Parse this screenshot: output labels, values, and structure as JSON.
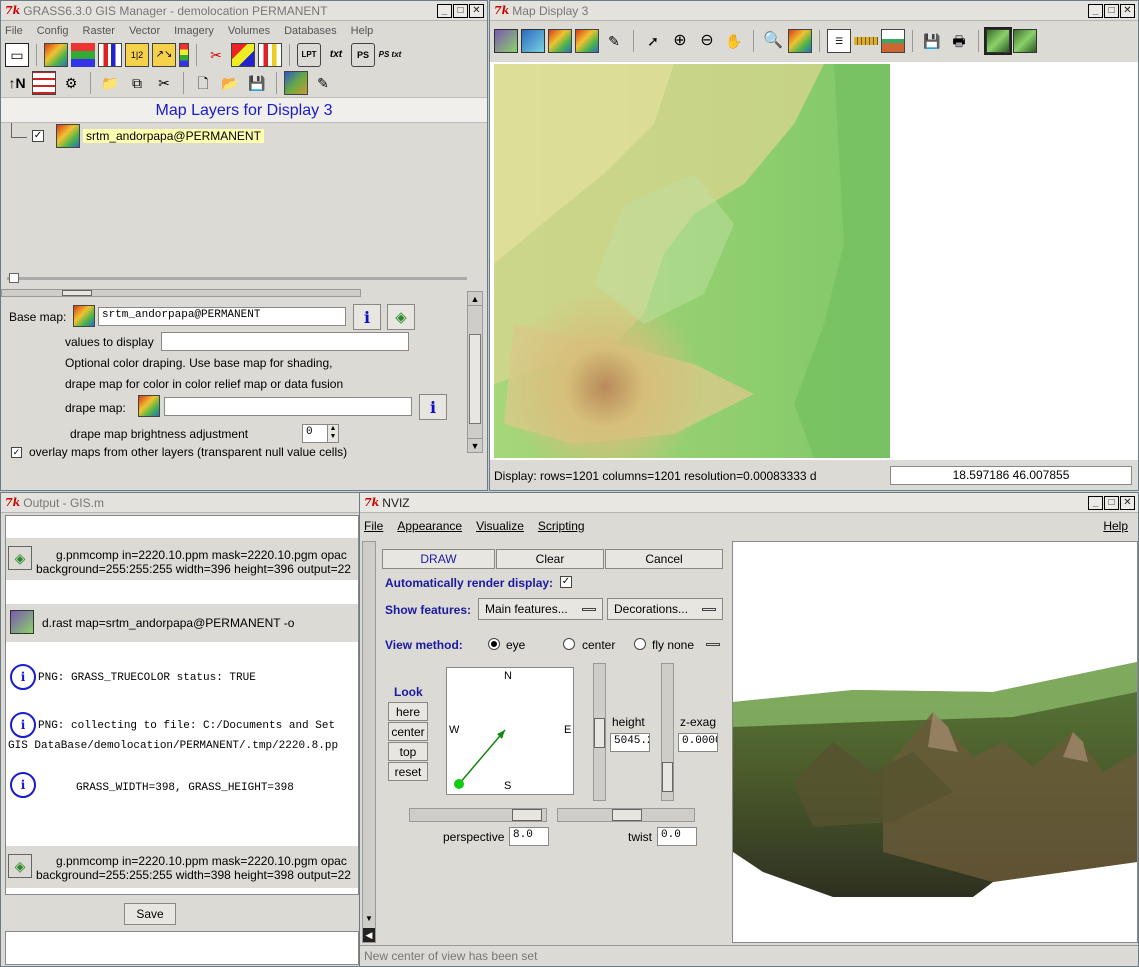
{
  "gis_manager": {
    "title": "GRASS6.3.0 GIS Manager - demolocation PERMANENT",
    "menu": [
      "File",
      "Config",
      "Raster",
      "Vector",
      "Imagery",
      "Volumes",
      "Databases",
      "Help"
    ],
    "toolbar1_labels": {
      "lpt": "LPT",
      "txt": "txt",
      "ps": "PS",
      "pstxt": "PS txt"
    },
    "panel_title": "Map Layers for Display 3",
    "layer_name": "srtm_andorpapa@PERMANENT",
    "base_map_label": "Base map:",
    "base_map_value": "srtm_andorpapa@PERMANENT",
    "values_label": "values to display",
    "values_value": "",
    "optional_text1": "Optional color draping. Use base map for shading,",
    "optional_text2": "drape map for color in color relief map or data fusion",
    "drape_label": "drape map:",
    "drape_value": "",
    "brightness_label": "drape map brightness adjustment",
    "brightness_value": "0",
    "overlay_text": "overlay maps from other layers (transparent null value cells)"
  },
  "map_display": {
    "title": "Map Display 3",
    "status_text": "Display: rows=1201 columns=1201  resolution=0.00083333 d",
    "coords": "18.597186 46.007855"
  },
  "output": {
    "title": "Output - GIS.m",
    "entries": [
      {
        "line1": "g.pnmcomp in=2220.10.ppm mask=2220.10.pgm opac",
        "line2": "background=255:255:255 width=396 height=396 output=22"
      },
      {
        "line1": "d.rast map=srtm_andorpapa@PERMANENT -o"
      },
      {
        "line1": "PNG: GRASS_TRUECOLOR status: TRUE"
      },
      {
        "line1": "PNG: collecting to file: C:/Documents and Set",
        "line2": "GIS DataBase/demolocation/PERMANENT/.tmp/2220.8.pp"
      },
      {
        "line1": "GRASS_WIDTH=398, GRASS_HEIGHT=398"
      },
      {
        "line1": "g.pnmcomp in=2220.10.ppm mask=2220.10.pgm opac",
        "line2": "background=255:255:255 width=398 height=398 output=22"
      }
    ],
    "save_label": "Save"
  },
  "nviz": {
    "title": "NVIZ",
    "menu": [
      "File",
      "Appearance",
      "Visualize",
      "Scripting"
    ],
    "help": "Help",
    "draw": "DRAW",
    "clear": "Clear",
    "cancel": "Cancel",
    "auto_render_label": "Automatically render display:",
    "show_features_label": "Show features:",
    "main_features": "Main features...",
    "decorations": "Decorations...",
    "view_method_label": "View method:",
    "view_eye": "eye",
    "view_center": "center",
    "view_fly": "fly none",
    "look_label": "Look",
    "look_buttons": [
      "here",
      "center",
      "top",
      "reset"
    ],
    "compass": {
      "n": "N",
      "s": "S",
      "e": "E",
      "w": "W"
    },
    "height_label": "height",
    "height_value": "5045.2",
    "zexag_label": "z-exag",
    "zexag_value": "0.0000",
    "perspective_label": "perspective",
    "perspective_value": "8.0",
    "twist_label": "twist",
    "twist_value": "0.0",
    "status": "New center of view has been set"
  },
  "colors": {
    "title_blue": "#1a1ad0",
    "nviz_label_blue": "#1a1aa0",
    "layer_highlight": "#ffffb0"
  }
}
